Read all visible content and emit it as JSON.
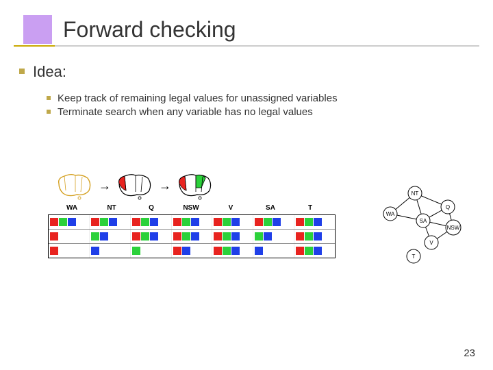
{
  "title": "Forward checking",
  "bullets": {
    "level1": "Idea:",
    "level2": [
      "Keep track of remaining legal values for unassigned variables",
      "Terminate search when any variable has no legal values"
    ]
  },
  "figure": {
    "headers": [
      "WA",
      "NT",
      "Q",
      "NSW",
      "V",
      "SA",
      "T"
    ],
    "rows": [
      {
        "WA": [
          "r",
          "g",
          "b"
        ],
        "NT": [
          "r",
          "g",
          "b"
        ],
        "Q": [
          "r",
          "g",
          "b"
        ],
        "NSW": [
          "r",
          "g",
          "b"
        ],
        "V": [
          "r",
          "g",
          "b"
        ],
        "SA": [
          "r",
          "g",
          "b"
        ],
        "T": [
          "r",
          "g",
          "b"
        ]
      },
      {
        "WA": [
          "r"
        ],
        "NT": [
          "g",
          "b"
        ],
        "Q": [
          "r",
          "g",
          "b"
        ],
        "NSW": [
          "r",
          "g",
          "b"
        ],
        "V": [
          "r",
          "g",
          "b"
        ],
        "SA": [
          "g",
          "b"
        ],
        "T": [
          "r",
          "g",
          "b"
        ]
      },
      {
        "WA": [
          "r"
        ],
        "NT": [
          "b"
        ],
        "Q": [
          "g"
        ],
        "NSW": [
          "r",
          "b"
        ],
        "V": [
          "r",
          "g",
          "b"
        ],
        "SA": [
          "b"
        ],
        "T": [
          "r",
          "g",
          "b"
        ]
      }
    ],
    "graph_nodes": [
      "NT",
      "WA",
      "Q",
      "SA",
      "NSW",
      "V",
      "T"
    ]
  },
  "page_number": "23",
  "colors": {
    "accent_purple": "#8a2be2",
    "bullet_olive": "#bfa84a",
    "underline_yellow": "#c9a800",
    "red": "#e8231f",
    "green": "#2bd13a",
    "blue": "#1f3fe8"
  }
}
